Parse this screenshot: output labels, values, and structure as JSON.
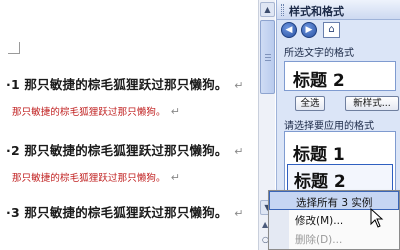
{
  "document": {
    "lines": [
      {
        "kind": "heading",
        "number": "·1",
        "text": "那只敏捷的棕毛狐狸跃过那只懒狗。",
        "mark": "↵"
      },
      {
        "kind": "body",
        "text": "那只敏捷的棕毛狐狸跃过那只懒狗。",
        "mark": "↵"
      },
      {
        "kind": "heading",
        "number": "·2",
        "text": "那只敏捷的棕毛狐狸跃过那只懒狗。",
        "mark": "↵"
      },
      {
        "kind": "body",
        "text": "那只敏捷的棕毛狐狸跃过那只懒狗。",
        "mark": "↵"
      },
      {
        "kind": "heading",
        "number": "·3",
        "text": "那只敏捷的棕毛狐狸跃过那只懒狗。",
        "mark": "↵"
      }
    ],
    "colors": {
      "heading": "#1a1a1a",
      "body": "#c02020"
    }
  },
  "scrollbar": {
    "up_icon": "▲",
    "down_icon": "▼",
    "prev_page_icon": "▲",
    "next_page_icon": "○"
  },
  "task_pane": {
    "title": "样式和格式",
    "nav": {
      "back_icon": "◀",
      "forward_icon": "▶",
      "home_icon": "⌂"
    },
    "selected_text_label": "所选文字的格式",
    "current_style": "标题 2",
    "select_all_label": "全选",
    "new_style_label": "新样式...",
    "apply_label": "请选择要应用的格式",
    "styles": [
      "标题 1",
      "标题 2"
    ],
    "accent": "#2f5fc0"
  },
  "context_menu": {
    "items": [
      {
        "label": "选择所有 3 实例",
        "state": "hover"
      },
      {
        "label": "修改(M)...",
        "mnemonic": "M",
        "state": "normal"
      },
      {
        "label": "删除(D)...",
        "mnemonic": "D",
        "state": "disabled"
      }
    ]
  }
}
